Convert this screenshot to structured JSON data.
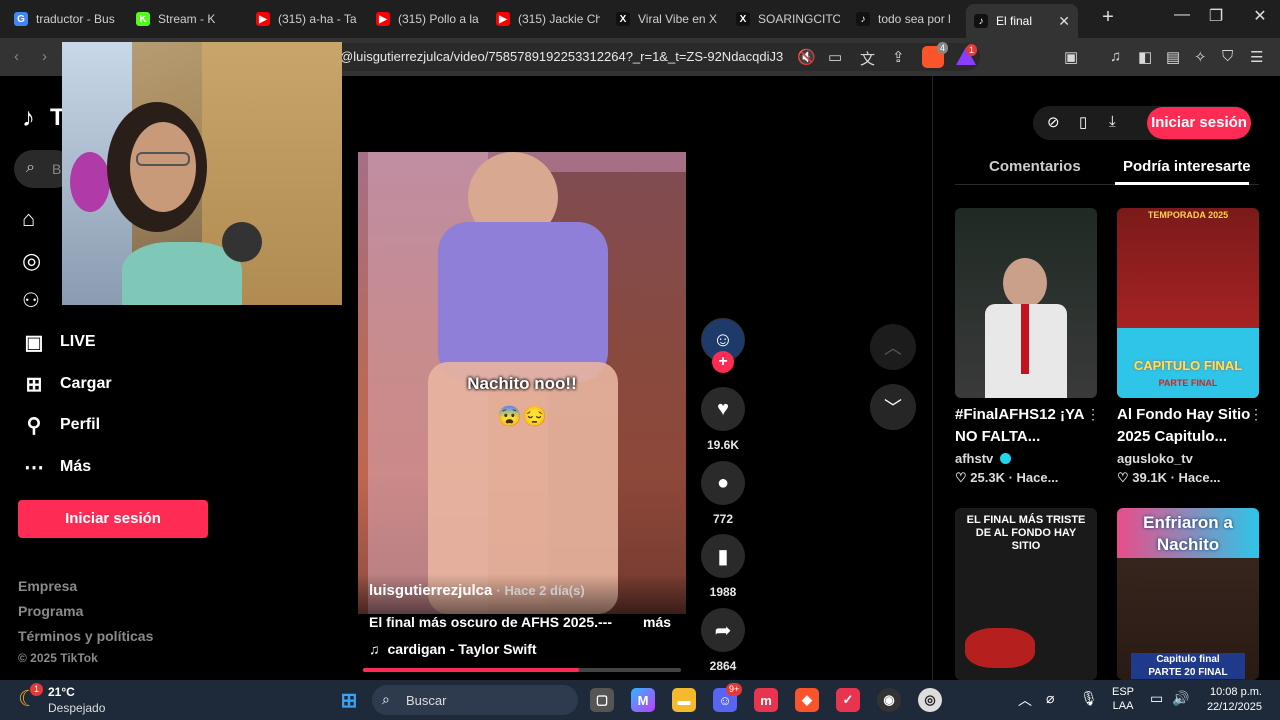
{
  "browser": {
    "tabs": [
      {
        "label": "traductor - Bus",
        "icon": "google-icon",
        "color": "#4285f4",
        "glyph": "G"
      },
      {
        "label": "Stream - K",
        "icon": "kick-icon",
        "color": "#53fc18",
        "glyph": "K"
      },
      {
        "label": "(315) a-ha - Ta",
        "icon": "youtube-icon",
        "color": "#ff0000",
        "glyph": "▶"
      },
      {
        "label": "(315) Pollo a la",
        "icon": "youtube-icon",
        "color": "#ff0000",
        "glyph": "▶"
      },
      {
        "label": "(315) Jackie Ch",
        "icon": "youtube-icon",
        "color": "#ff0000",
        "glyph": "▶"
      },
      {
        "label": "Viral Vibe en X",
        "icon": "x-icon",
        "color": "#000000",
        "glyph": "X"
      },
      {
        "label": "SOARINGCITO",
        "icon": "x-icon",
        "color": "#000000",
        "glyph": "X"
      },
      {
        "label": "todo sea por l",
        "icon": "tiktok-icon",
        "color": "#000000",
        "glyph": "♪"
      },
      {
        "label": "El final",
        "icon": "tiktok-icon",
        "color": "#000000",
        "glyph": "♪"
      }
    ],
    "url": "@luisgutierrezjulca/video/7585789192253312264?_r=1&_t=ZS-92NdacqdiJ3",
    "shield_badge": "4",
    "alert_badge": "1"
  },
  "tiktok": {
    "search_placeholder": "B",
    "nav": [
      {
        "label": "LIVE",
        "icon": "live-icon"
      },
      {
        "label": "Cargar",
        "icon": "upload-icon"
      },
      {
        "label": "Perfil",
        "icon": "profile-icon"
      },
      {
        "label": "Más",
        "icon": "more-icon"
      }
    ],
    "login_button": "Iniciar sesión",
    "footer": [
      "Empresa",
      "Programa",
      "Términos y políticas",
      "© 2025 TikTok"
    ]
  },
  "video": {
    "caption_text": "Nachito noo!!",
    "caption_emoji": "😨😔",
    "author": "luisgutierrezjulca",
    "posted": "· Hace 2 día(s)",
    "description": "El final más oscuro de AFHS 2025.---",
    "more": "más",
    "music": "cardigan - Taylor Swift",
    "progress": 0.68,
    "likes": "19.6K",
    "comments": "772",
    "saves": "1988",
    "shares": "2864"
  },
  "right_panel": {
    "top_login": "Iniciar sesión",
    "tabs": [
      "Comentarios",
      "Podría interesarte"
    ],
    "active_tab": "Podría interesarte",
    "recommendations": [
      {
        "title": "#FinalAFHS12 ¡YA NO FALTA...",
        "author": "afhstv",
        "verified": true,
        "stats": "♡ 25.3K · Hace..."
      },
      {
        "title": "Al Fondo Hay Sitio 2025 Capitulo...",
        "author": "agusloko_tv",
        "verified": false,
        "stats": "♡ 39.1K · Hace...",
        "thumb_top": "TEMPORADA 2025",
        "thumb_label": "CAPITULO FINAL",
        "thumb_sub": "PARTE FINAL"
      },
      {
        "thumb_label": "EL FINAL MÁS TRISTE DE AL FONDO HAY SITIO"
      },
      {
        "thumb_label": "Enfriaron a Nachito",
        "thumb_sub": "Capitulo final",
        "thumb_sub2": "PARTE 20 FINAL"
      }
    ]
  },
  "taskbar": {
    "weather_temp": "21°C",
    "weather_desc": "Despejado",
    "weather_badge": "1",
    "search": "Buscar",
    "discord_badge": "9+",
    "lang_top": "ESP",
    "lang_bottom": "LAA",
    "time": "10:08 p.m.",
    "date": "22/12/2025"
  }
}
